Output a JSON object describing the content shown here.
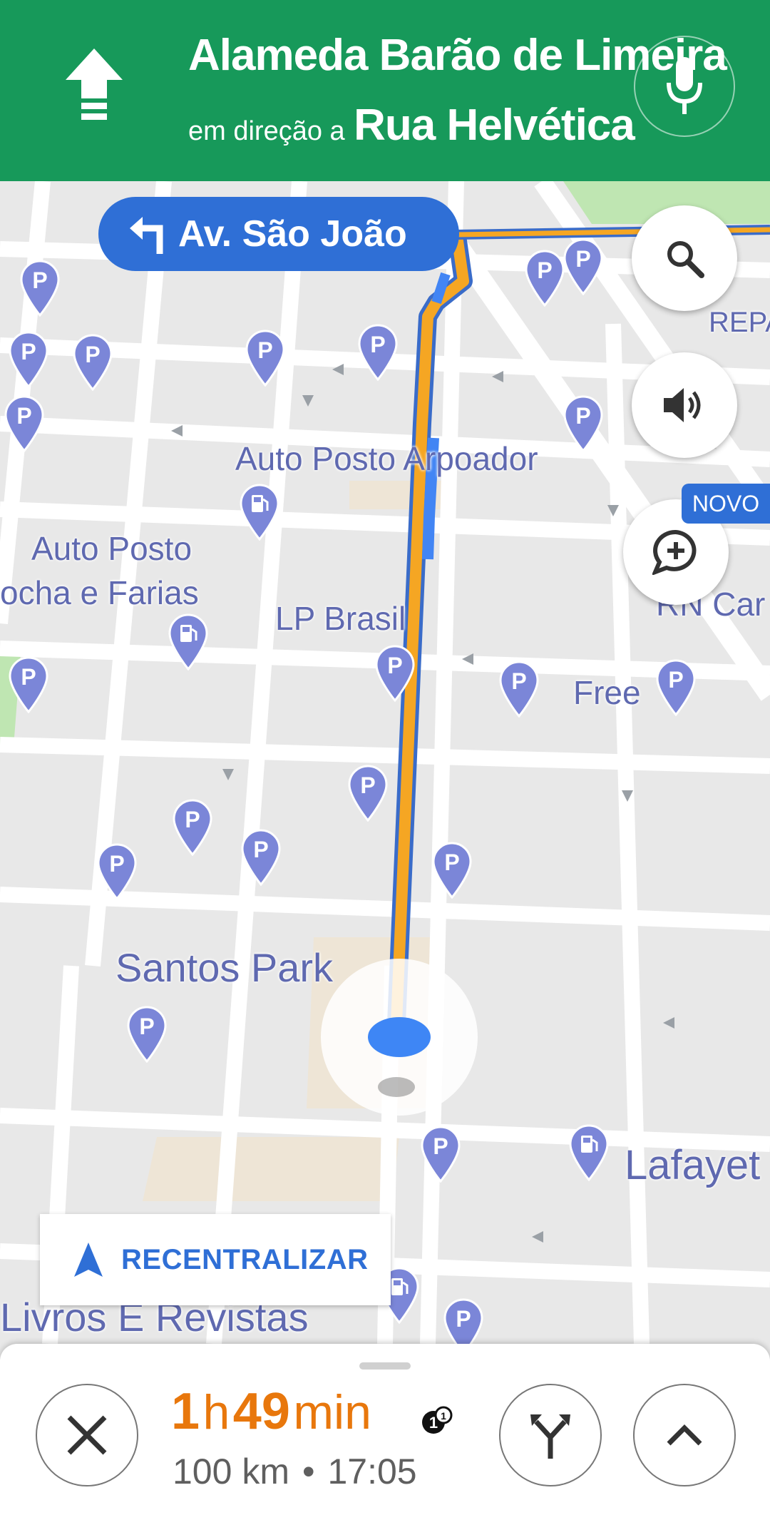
{
  "header": {
    "street": "Alameda Barão de Limeira",
    "toward_prefix": "em direção a",
    "toward_street": "Rua Helvética",
    "bg_color": "#17995a"
  },
  "turn_banner": {
    "street": "Av. São João",
    "icon": "turn-left-arrow-icon"
  },
  "map": {
    "labels": {
      "auto_posto_arpoador": "Auto Posto Arpoador",
      "auto_posto": "Auto Posto",
      "rocha_e_farias": "ocha e Farias",
      "lp_brasil": "LP Brasil",
      "free": "Free",
      "santos_park": "Santos Park",
      "lafayette": "Lafayet",
      "livros": "Livros E Revistas",
      "repa": "REPA",
      "rn_car": "RN Car"
    }
  },
  "buttons": {
    "search_icon": "search-icon",
    "sound_icon": "volume-icon",
    "report_icon": "add-report-icon",
    "novo_badge": "NOVO",
    "recenter_label": "RECENTRALIZAR"
  },
  "bottom": {
    "eta_hours": "1",
    "eta_h_unit": "h",
    "eta_minutes": "49",
    "eta_min_unit": "min",
    "distance": "100 km",
    "separator": "•",
    "arrival_time": "17:05"
  },
  "colors": {
    "route_orange": "#f5a623",
    "route_blue": "#4285f4",
    "accent_blue": "#2f6fd6",
    "eta_orange": "#e8770c"
  }
}
